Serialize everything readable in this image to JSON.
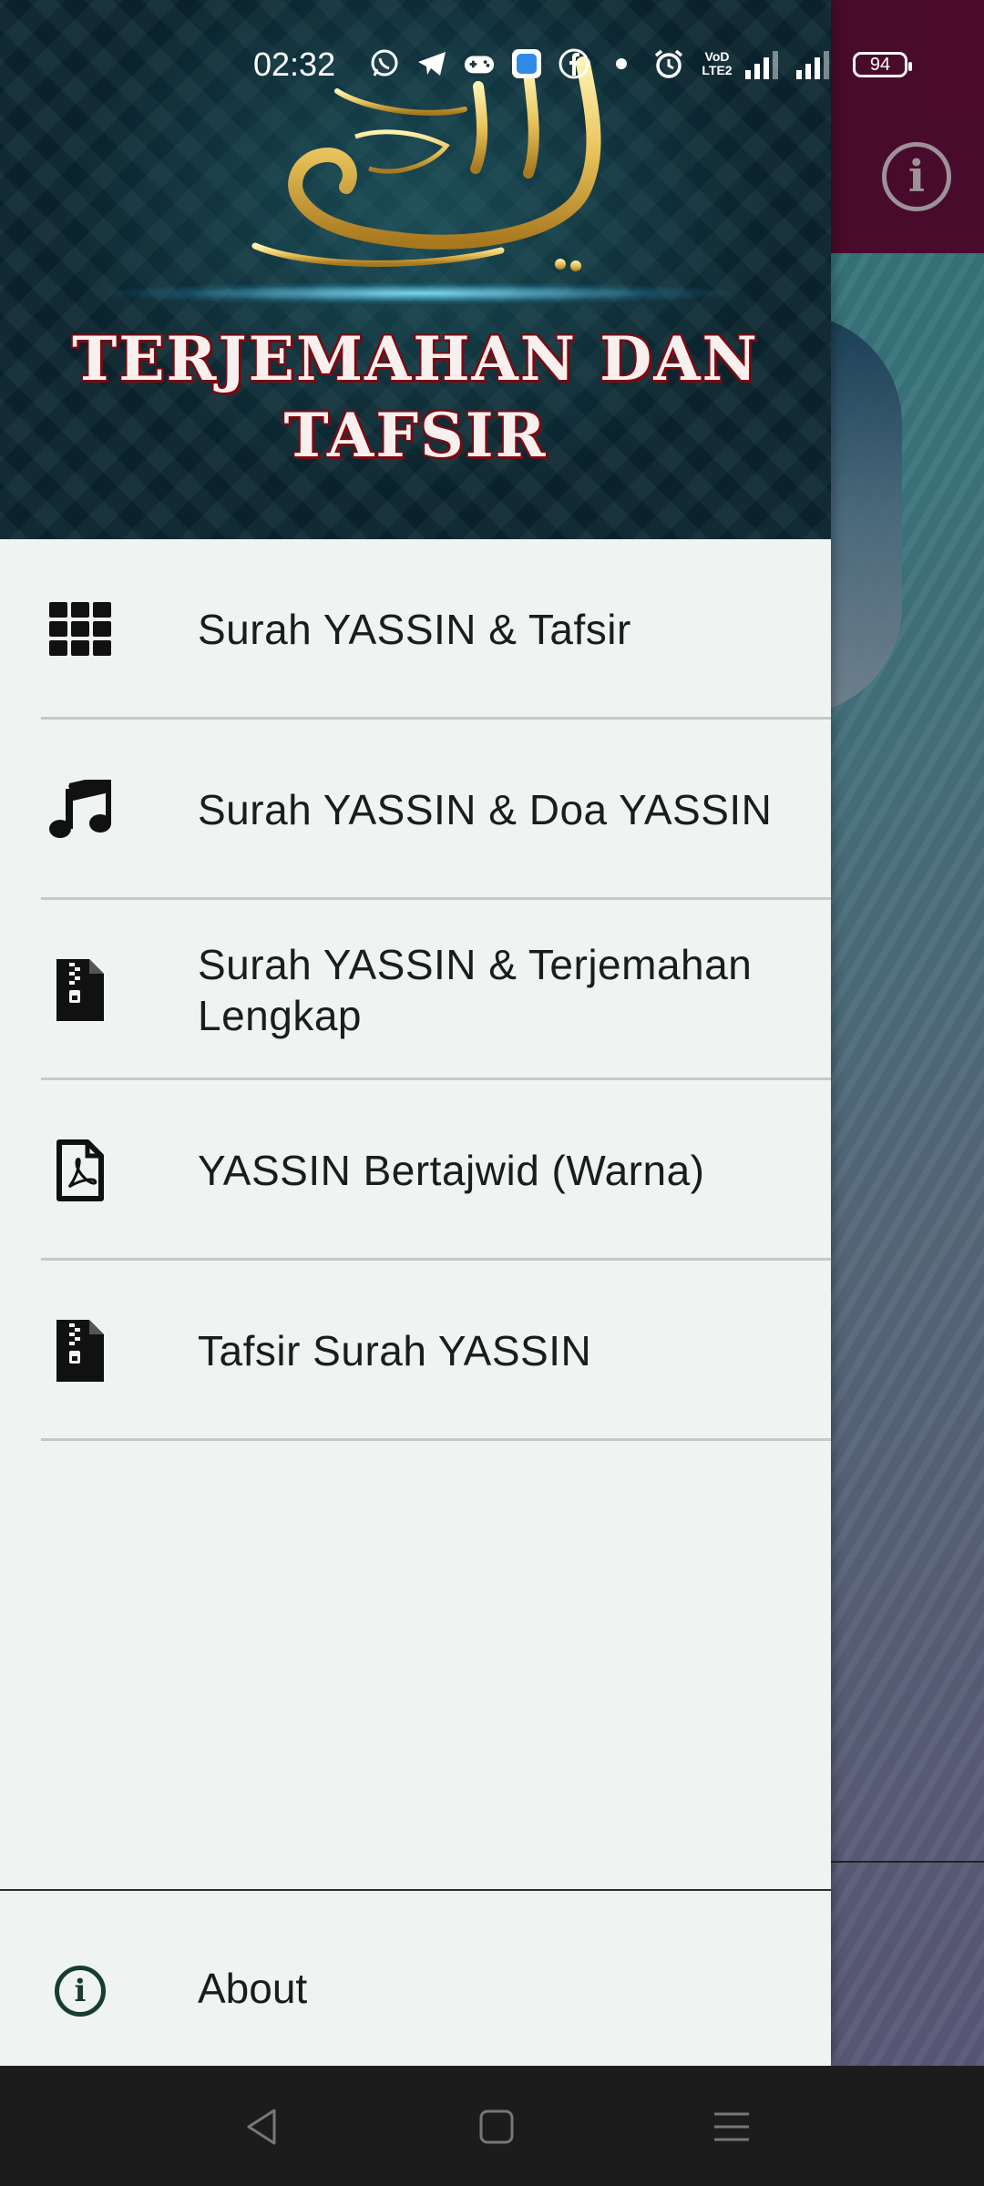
{
  "status_bar": {
    "time": "02:32",
    "battery": "94",
    "notification_icons": [
      "whatsapp-icon",
      "telegram-icon",
      "gamepad-icon",
      "app-icon",
      "facebook-icon",
      "dot-icon",
      "alarm-icon"
    ],
    "network_label_top": "VoD",
    "network_label_bottom": "LTE2"
  },
  "drawer": {
    "header": {
      "arabic_text": "يس والقرآن الحكيم",
      "title_line1": "TERJEMAHAN DAN",
      "title_line2": "TAFSIR"
    },
    "items": [
      {
        "label": "Surah YASSIN & Tafsir",
        "icon": "grid-icon"
      },
      {
        "label": "Surah YASSIN & Doa YASSIN",
        "icon": "music-note-icon"
      },
      {
        "label": "Surah YASSIN & Terjemahan Lengkap",
        "icon": "zip-file-icon"
      },
      {
        "label": "YASSIN Bertajwid (Warna)",
        "icon": "pdf-file-icon"
      },
      {
        "label": "Tafsir Surah YASSIN",
        "icon": "zip-file-icon"
      }
    ],
    "footer": {
      "label": "About",
      "icon": "info-icon"
    }
  },
  "app": {
    "toolbar_color": "#5a0e35",
    "info_icon": "info-icon"
  },
  "nav_bar": {
    "buttons": [
      "back-icon",
      "home-icon",
      "menu-icon"
    ]
  }
}
